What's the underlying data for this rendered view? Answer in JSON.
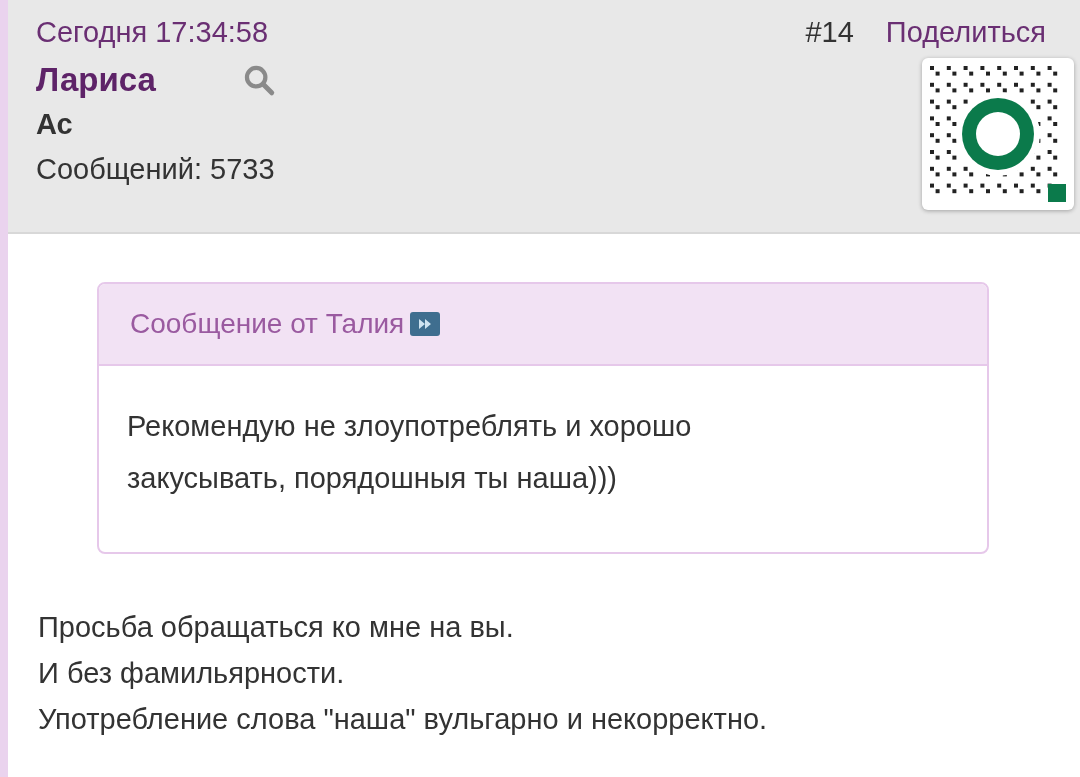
{
  "post": {
    "date": "Сегодня 17:34:58",
    "number": "#14",
    "share": "Поделиться",
    "author": "Лариса",
    "rank": "Ас",
    "messages": "Сообщений: 5733"
  },
  "quote": {
    "header": "Сообщение от Талия",
    "text": "Рекомендую не злоупотреблять и хорошо закусывать, порядошныя ты наша)))"
  },
  "body": [
    "Просьба обращаться ко мне на вы.",
    "И без фамильярности.",
    "Употребление слова \"наша\" вульгарно и некорректно."
  ]
}
